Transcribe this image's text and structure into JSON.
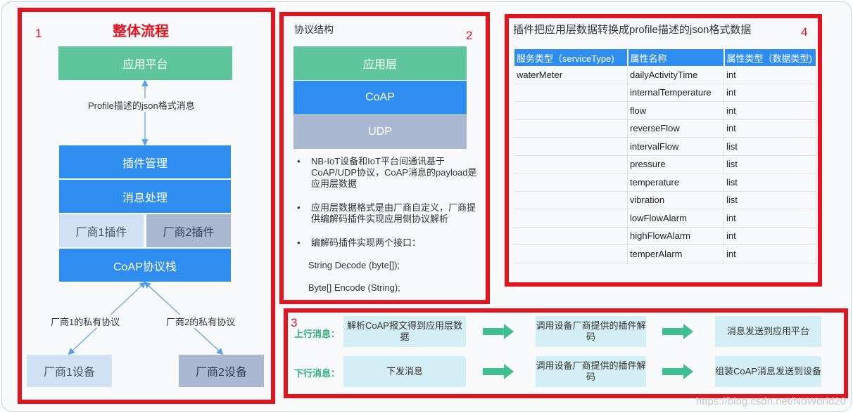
{
  "section_numbers": {
    "s1": "1",
    "s2": "2",
    "s3": "3",
    "s4": "4"
  },
  "overall": {
    "title": "整体流程",
    "app_platform": "应用平台",
    "profile_msg": "Profile描述的json格式消息",
    "plugin_mgmt": "插件管理",
    "msg_processing": "消息处理",
    "vendor1_plugin": "厂商1插件",
    "vendor2_plugin": "厂商2插件",
    "coap_stack": "CoAP协议栈",
    "vendor1_private": "厂商1的私有协议",
    "vendor2_private": "厂商2的私有协议",
    "vendor1_device": "厂商1设备",
    "vendor2_device": "厂商2设备"
  },
  "protocol": {
    "title": "协议结构",
    "layers": [
      "应用层",
      "CoAP",
      "UDP"
    ],
    "bullets": [
      "NB-IoT设备和IoT平台间通讯基于CoAP/UDP协议，CoAP消息的payload是应用层数据",
      "应用层数据格式是由厂商自定义，厂商提供编解码插件实现应用侧协议解析",
      "编解码插件实现两个接口："
    ],
    "code_lines": [
      "String Decode (byte[]);",
      "Byte[] Encode (String);"
    ]
  },
  "conversion": {
    "title": "插件把应用层数据转换成profile描述的json格式数据",
    "headers": [
      "服务类型（serviceType)",
      "属性名称",
      "属性类型（数据类型)"
    ],
    "rows": [
      [
        "waterMeter",
        "dailyActivityTime",
        "int"
      ],
      [
        "",
        "internalTemperature",
        "int"
      ],
      [
        "",
        "flow",
        "int"
      ],
      [
        "",
        "reverseFlow",
        "int"
      ],
      [
        "",
        "intervalFlow",
        "list"
      ],
      [
        "",
        "pressure",
        "list"
      ],
      [
        "",
        "temperature",
        "list"
      ],
      [
        "",
        "vibration",
        "list"
      ],
      [
        "",
        "lowFlowAlarm",
        "int"
      ],
      [
        "",
        "highFlowAlarm",
        "int"
      ],
      [
        "",
        "temperAlarm",
        "int"
      ]
    ]
  },
  "flows": {
    "uplink_label": "上行消息：",
    "uplink_steps": [
      "解析CoAP报文得到应用层数据",
      "调用设备厂商提供的插件解码",
      "消息发送到应用平台"
    ],
    "downlink_label": "下行消息：",
    "downlink_steps": [
      "下发消息",
      "调用设备厂商提供的插件解码",
      "组装CoAP消息发送到设备"
    ]
  },
  "watermark": "https://blog.csdn.net/NoWorld20",
  "colors": {
    "red_frame": "#e3141e",
    "green": "#5ec59d",
    "blue": "#2f8df0",
    "arrow": "#3fbf8f"
  }
}
